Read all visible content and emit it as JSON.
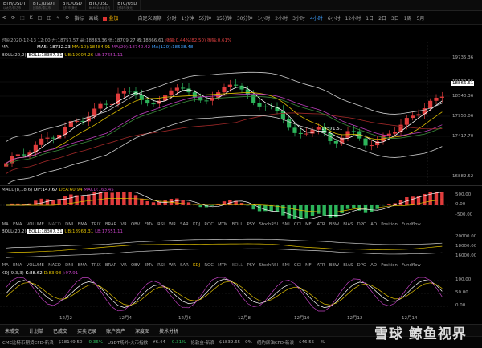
{
  "tabs": [
    {
      "t1": "ETH/USDT",
      "t2": "以太坊/泰达币"
    },
    {
      "t1": "BTC/USDT",
      "t2": "比特币/泰达币",
      "active": true
    },
    {
      "t1": "BTC/USD",
      "t2": "比特币/美元"
    },
    {
      "t1": "BTC/USD",
      "t2": "BitMEX永续合约"
    },
    {
      "t1": "BTC/USD",
      "t2": "比特币/美元"
    }
  ],
  "toolbar": {
    "left": [
      "⟲",
      "⟳",
      "⬚",
      "K",
      "□",
      "◫",
      "∿",
      "⚙",
      "指标",
      "画线"
    ],
    "chk_label": "叠加",
    "items": [
      "自定义周期",
      "分时",
      "1分钟",
      "5分钟",
      "15分钟",
      "30分钟",
      "1小时",
      "2小时",
      "3小时",
      "4小时",
      "6小时",
      "12小时",
      "1日",
      "2日",
      "3日",
      "1周",
      "5月"
    ],
    "active_item": "4小时"
  },
  "info": {
    "time": "时间2020-12-13 12:00",
    "open": "开:18757.57",
    "high": "高:18883.36",
    "low": "低:18709.27",
    "close": "收:18866.61",
    "change": "涨幅:0.44%(82.50)",
    "amp": "振幅:0.61%",
    "ma_label": "MA",
    "boll_label": "BOLL(20,2)",
    "ma5": "MA5: 18732.23",
    "ma10": "MA(10):18484.91",
    "ma20": "MA(20):18740.42",
    "ma120": "MA(120):18538.48",
    "boll_mid": "BOLL:18307.31",
    "boll_ub": "UB:19004.26",
    "boll_lb": "LB:17651.11"
  },
  "price_axis": [
    "19735.36",
    "19130.66",
    "18540.36",
    "17950.06",
    "17417.70",
    "16882.52"
  ],
  "current_price": "18866.61",
  "low_mark": "17571.51",
  "macd": {
    "label": "MACD(8,18,6)",
    "dif": "DIF:147.67",
    "dea": "DEA:60.94",
    "macd": "MACD:163.45",
    "axis": [
      "500.00",
      "0.00",
      "-500.00"
    ]
  },
  "ind_tabs_1": [
    "MA",
    "EMA",
    "VOLUME",
    "MACD",
    "DMI",
    "BMA",
    "TRIX",
    "BRAR",
    "VR",
    "OBV",
    "EMV",
    "RSI",
    "WR",
    "SAR",
    "KDJ",
    "ROC",
    "MTM",
    "BOLL",
    "PSY",
    "StochRSI",
    "SMI",
    "CCI",
    "MFI",
    "ATR",
    "BBW",
    "BIAS",
    "DPO",
    "AO",
    "Position",
    "Fundflow"
  ],
  "boll2": {
    "label": "BOLL(20,2)",
    "mid": "BOLL:18307.31",
    "ub": "UB:18963.31",
    "lb": "LB:17651.11",
    "axis": [
      "20000.00",
      "18000.00",
      "16000.00"
    ]
  },
  "ind_tabs_2": [
    "MA",
    "EMA",
    "VOLUME",
    "MACD",
    "DMI",
    "BMA",
    "TRIX",
    "BRAR",
    "VR",
    "OBV",
    "EMV",
    "RSI",
    "WR",
    "SAR",
    "KDJ",
    "ROC",
    "MTM",
    "BOLL",
    "PSY",
    "StochRSI",
    "SMI",
    "CCI",
    "MFI",
    "ATR",
    "BBW",
    "BIAS",
    "DPO",
    "AO",
    "Position",
    "Fundflow"
  ],
  "kdj": {
    "label": "KDJ(9,3,3)",
    "k": "K:88.62",
    "d": "D:83.98",
    "j": "J:97.91",
    "axis": [
      "100.00",
      "50.00",
      "0.00"
    ]
  },
  "dates": [
    "12月2",
    "12月4",
    "12月6",
    "12月8",
    "12月10",
    "12月12",
    "12月14"
  ],
  "bottom_tabs": [
    "未成交",
    "计划单",
    "已成交",
    "买卖记录",
    "账户资产",
    "深度图",
    "技术分析"
  ],
  "status": [
    {
      "t": "CME比特币期货CFD-新浪",
      "c": ""
    },
    {
      "t": "$18149.50",
      "c": ""
    },
    {
      "t": "-0.36%",
      "c": "dn"
    },
    {
      "t": "USDT场外-火币指数",
      "c": ""
    },
    {
      "t": "¥6.44",
      "c": ""
    },
    {
      "t": "-0.31%",
      "c": "dn"
    },
    {
      "t": "伦敦金-新浪",
      "c": ""
    },
    {
      "t": "$1839.65",
      "c": ""
    },
    {
      "t": "0%",
      "c": ""
    },
    {
      "t": "纽约原油CFD-新浪",
      "c": ""
    },
    {
      "t": "$46.55",
      "c": ""
    },
    {
      "t": "-%",
      "c": ""
    }
  ],
  "watermark": "雪球 鲸鱼视界"
}
